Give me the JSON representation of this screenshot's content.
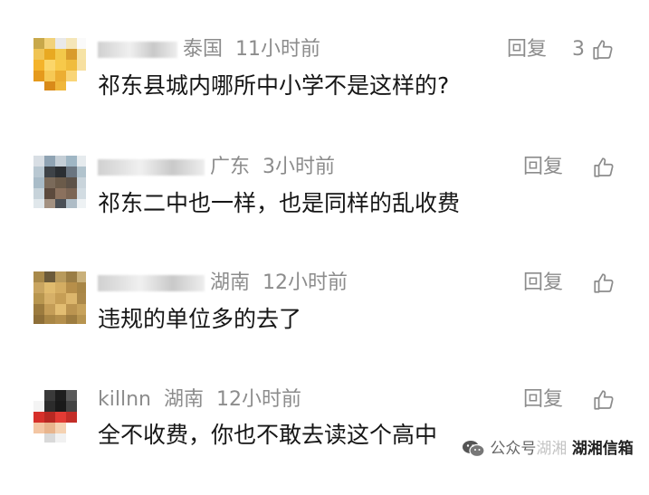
{
  "actions": {
    "reply_label": "回复"
  },
  "comments": [
    {
      "location": "泰国",
      "time": "11小时前",
      "likes": "3",
      "text": "祁东县城内哪所中小学不是这样的?"
    },
    {
      "location": "广东",
      "time": "3小时前",
      "likes": "",
      "text": "祁东二中也一样，也是同样的乱收费"
    },
    {
      "location": "湖南",
      "time": "12小时前",
      "likes": "",
      "text": "违规的单位多的去了"
    },
    {
      "username": "killnn",
      "location": "湖南",
      "time": "12小时前",
      "likes": "",
      "text": "全不收费，你也不敢去读这个高中"
    }
  ],
  "watermark": {
    "label_prefix": "公众号",
    "label_faint": "湖湘",
    "label_strong": "湖湘信箱"
  },
  "icons": {
    "like": "thumbs-up-icon",
    "watermark": "wechat-icon"
  }
}
